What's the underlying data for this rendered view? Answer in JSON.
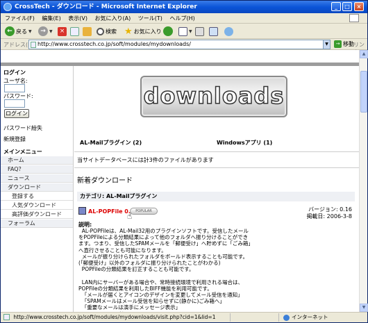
{
  "window": {
    "title": "CrossTech - ダウンロード - Microsoft Internet Explorer"
  },
  "menubar": [
    "ファイル(F)",
    "編集(E)",
    "表示(V)",
    "お気に入り(A)",
    "ツール(T)",
    "ヘルプ(H)"
  ],
  "toolbar": {
    "back": "戻る",
    "search": "検索",
    "favorites": "お気に入り"
  },
  "address": {
    "label": "アドレス(D)",
    "url": "http://www.crosstech.co.jp/soft/modules/mydownloads/",
    "go": "移動",
    "links": "リンク"
  },
  "sidebar": {
    "login_heading": "ログイン",
    "username_label": "ユーザ名:",
    "password_label": "パスワード:",
    "login_button": "ログイン",
    "lost_password": "パスワード紛失",
    "register": "新規登録",
    "menu_heading": "メインメニュー",
    "items": [
      {
        "label": "ホーム",
        "sub": false
      },
      {
        "label": "FAQ？",
        "sub": false
      },
      {
        "label": "ニュース",
        "sub": false
      },
      {
        "label": "ダウンロード",
        "sub": false
      },
      {
        "label": "登録する",
        "sub": true
      },
      {
        "label": "人気ダウンロード",
        "sub": true
      },
      {
        "label": "高評価ダウンロード",
        "sub": true
      },
      {
        "label": "フォーラム",
        "sub": false
      }
    ]
  },
  "main": {
    "logo_text": "downloads",
    "category_1": "AL-Mailプラグイン (2)",
    "category_2": "Windowsアプリ (1)",
    "total_text": "当サイトデータベースには計3件のファイルがあります",
    "new_heading": "新着ダウンロード",
    "category_label": "カテゴリ: AL-Mailプラグイン",
    "file_name": "AL-POPFile 0.16",
    "popular_badge": "POPULAR",
    "version": "バージョン: 0.16",
    "date": "掲載日: 2006-3-8",
    "desc_heading": "説明:",
    "description": "  AL-POPFileは、AL-Mail32用のプラグインソフトです。受信したメール\nをPOPFileによる分類結果によって他のフォルダへ振り分けることができ\nます。つまり、受信したSPAMメールを「郵便受け」へ貯めずに「ごみ箱」\nへ直行させることも可能になります。\n  メールが振り分けられたフォルダをボールド表示することも可能です。\n(「郵便受け」以外のフォルダに振り分けられたことがわかる)\n  POPFileの分類結果を訂正することも可能です。\n\n  LAN内にサーバーがある場合や、常時接続環境で利用される場合は、\nPOPFileの分類結果を利用したBIFF機能を利用可能です。\n  「メールが届くとアイコンのデザインを変更してメール受信を通知」\n  「SPAMメールはメール受信を知らせずに(静かに)ごみ箱へ」\n  「重要なメールは演手にメッセージ表示」\n  といったように利用できます。\n(この機能を利用するためには、色々と前提条件がありますので、、)"
  },
  "status": {
    "url": "http://www.crosstech.co.jp/soft/modules/mydownloads/visit.php?cid=1&lid=1",
    "zone": "インターネット"
  }
}
